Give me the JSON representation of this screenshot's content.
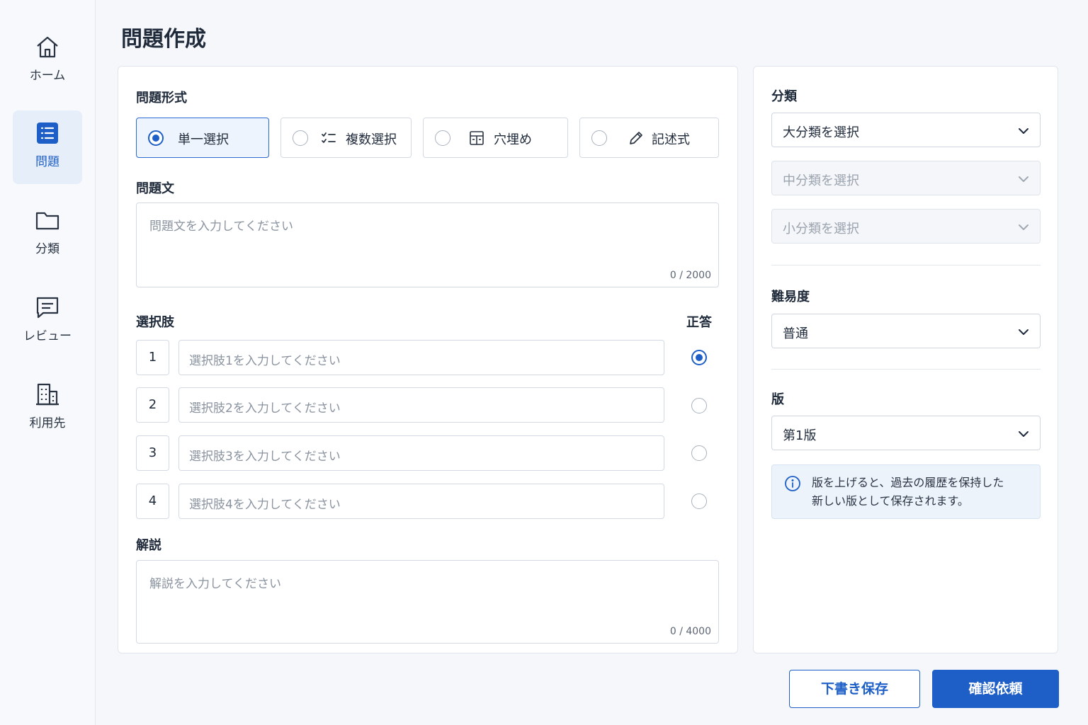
{
  "sidebar": {
    "items": [
      {
        "label": "ホーム",
        "icon": "home-icon",
        "active": false
      },
      {
        "label": "問題",
        "icon": "list-icon",
        "active": true
      },
      {
        "label": "分類",
        "icon": "folder-icon",
        "active": false
      },
      {
        "label": "レビュー",
        "icon": "comment-icon",
        "active": false
      },
      {
        "label": "利用先",
        "icon": "building-icon",
        "active": false
      }
    ]
  },
  "page": {
    "title": "問題作成"
  },
  "form": {
    "type_label": "問題形式",
    "types": [
      {
        "label": "単一選択",
        "selected": true
      },
      {
        "label": "複数選択",
        "selected": false,
        "icon": "checklist-icon"
      },
      {
        "label": "穴埋め",
        "selected": false,
        "icon": "table-icon"
      },
      {
        "label": "記述式",
        "selected": false,
        "icon": "pencil-icon"
      }
    ],
    "question_label": "問題文",
    "question_placeholder": "問題文を入力してください",
    "question_counter": "0 / 2000",
    "choices_label": "選択肢",
    "correct_label": "正答",
    "choices": [
      {
        "number": "1",
        "placeholder": "選択肢1を入力してください",
        "correct": true
      },
      {
        "number": "2",
        "placeholder": "選択肢2を入力してください",
        "correct": false
      },
      {
        "number": "3",
        "placeholder": "選択肢3を入力してください",
        "correct": false
      },
      {
        "number": "4",
        "placeholder": "選択肢4を入力してください",
        "correct": false
      }
    ],
    "explanation_label": "解説",
    "explanation_placeholder": "解説を入力してください",
    "explanation_counter": "0 / 4000"
  },
  "side": {
    "category_label": "分類",
    "major": "大分類を選択",
    "middle": "中分類を選択",
    "minor": "小分類を選択",
    "difficulty_label": "難易度",
    "difficulty": "普通",
    "version_label": "版",
    "version": "第1版",
    "info_line1": "版を上げると、過去の履歴を保持した",
    "info_line2": "新しい版として保存されます。"
  },
  "actions": {
    "draft": "下書き保存",
    "submit": "確認依頼"
  },
  "colors": {
    "accent": "#1e5fc7",
    "background": "#f5f7fa"
  }
}
